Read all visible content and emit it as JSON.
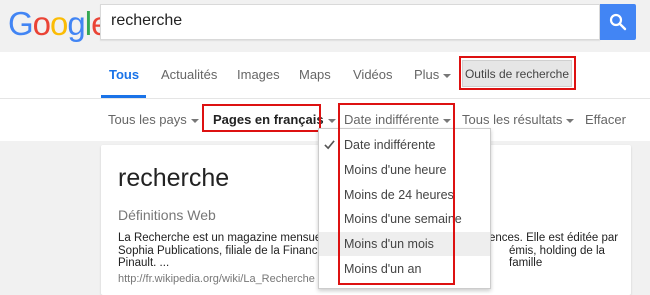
{
  "logo": {
    "letters": [
      "G",
      "o",
      "o",
      "g",
      "l",
      "e"
    ],
    "colors": [
      "#4285f4",
      "#ea4335",
      "#fbbc05",
      "#4285f4",
      "#34a853",
      "#ea4335"
    ]
  },
  "search": {
    "query": "recherche"
  },
  "tabs": [
    {
      "label": "Tous",
      "active": true
    },
    {
      "label": "Actualités"
    },
    {
      "label": "Images"
    },
    {
      "label": "Maps"
    },
    {
      "label": "Vidéos"
    },
    {
      "label": "Plus"
    }
  ],
  "outils_label": "Outils de recherche",
  "tools": {
    "country": "Tous les pays",
    "language": "Pages en français",
    "date": "Date indifférente",
    "results": "Tous les résultats",
    "clear": "Effacer"
  },
  "date_menu": [
    {
      "label": "Date indifférente",
      "checked": true
    },
    {
      "label": "Moins d'une heure"
    },
    {
      "label": "Moins de 24 heures"
    },
    {
      "label": "Moins d'une semaine"
    },
    {
      "label": "Moins d'un mois",
      "hover": true
    },
    {
      "label": "Moins d'un an"
    }
  ],
  "card": {
    "title": "recherche",
    "subtitle": "Définitions Web",
    "snippet_lines": [
      "La Recherche est un magazine mensuel",
      "Sophia Publications, filiale de la Financiè",
      "Pinault. ..."
    ],
    "snippet_right_lines": [
      "ences. Elle est éditée par",
      "émis, holding de la famille"
    ],
    "url": "http://fr.wikipedia.org/wiki/La_Recherche"
  },
  "colors": {
    "accent": "#1a73e8",
    "highlight": "#dd1111",
    "search_button": "#4285f4"
  }
}
